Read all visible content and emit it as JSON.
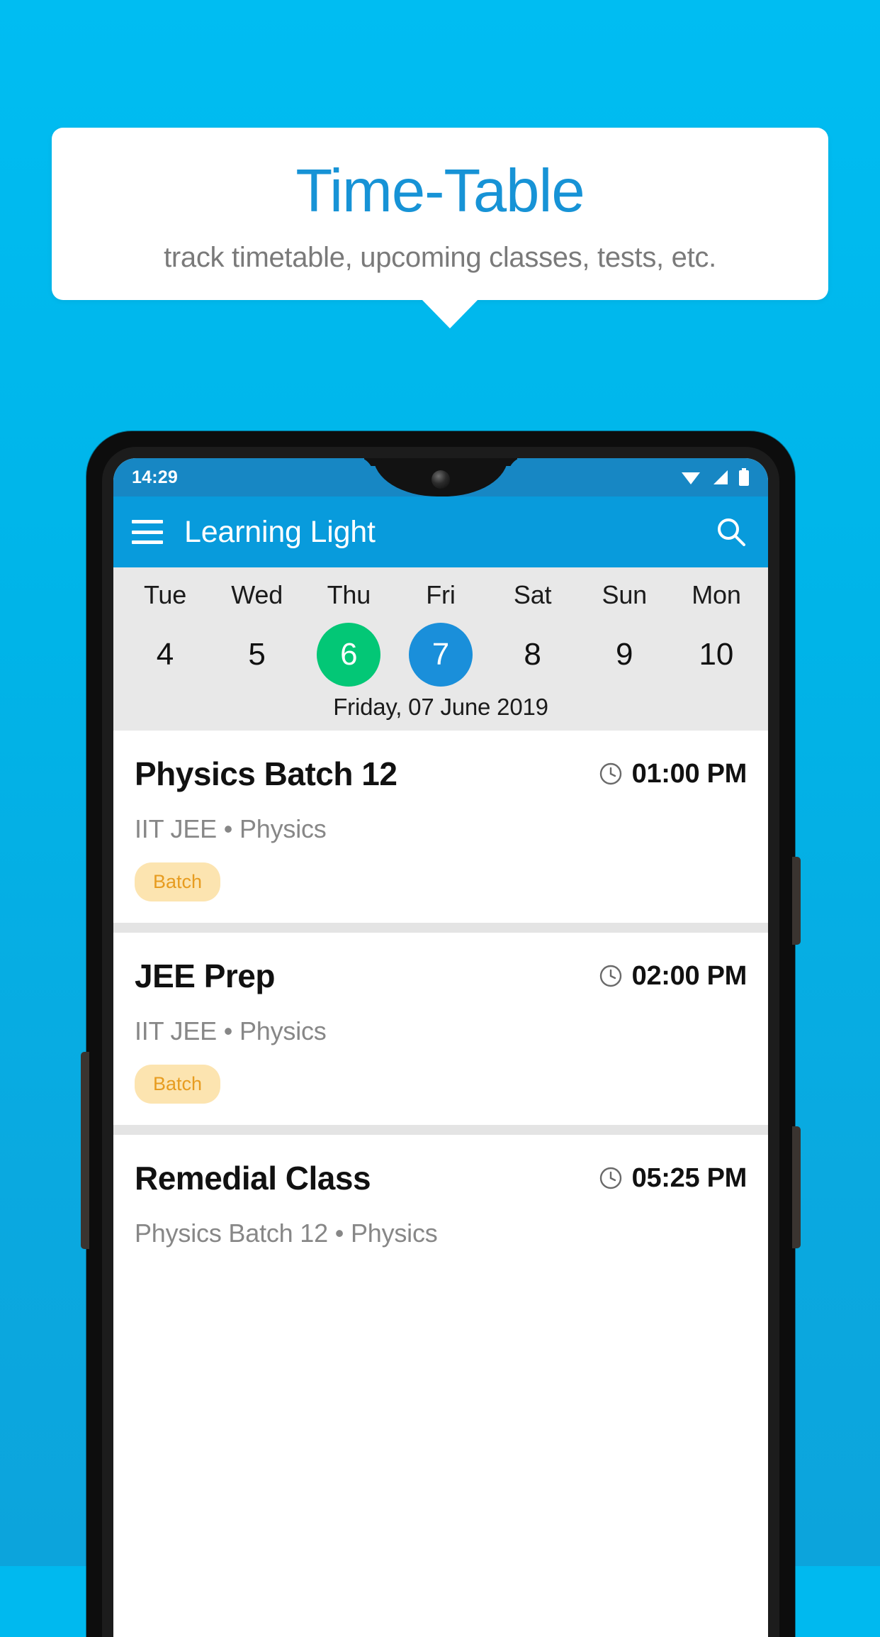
{
  "colors": {
    "background": "#00BDF2",
    "accent_blue": "#1793D6",
    "appbar_blue": "#089BDC",
    "statusbar_blue": "#1787C4",
    "selected_green": "#03C776",
    "selected_blue": "#1A8FDA",
    "badge_bg": "#FCE4B0",
    "badge_text": "#E79C20",
    "strip_gray": "#E8E8E8"
  },
  "callout": {
    "title": "Time-Table",
    "subtitle": "track timetable, upcoming classes, tests, etc."
  },
  "phone": {
    "statusbar": {
      "time": "14:29",
      "icons": [
        "wifi-icon",
        "signal-icon",
        "battery-icon"
      ]
    },
    "appbar": {
      "menu_icon": "hamburger-menu-icon",
      "title": "Learning Light",
      "search_icon": "search-icon"
    },
    "datestrip": {
      "days": [
        {
          "name": "Tue",
          "num": "4",
          "state": "normal"
        },
        {
          "name": "Wed",
          "num": "5",
          "state": "normal"
        },
        {
          "name": "Thu",
          "num": "6",
          "state": "today"
        },
        {
          "name": "Fri",
          "num": "7",
          "state": "selected"
        },
        {
          "name": "Sat",
          "num": "8",
          "state": "normal"
        },
        {
          "name": "Sun",
          "num": "9",
          "state": "normal"
        },
        {
          "name": "Mon",
          "num": "10",
          "state": "normal"
        }
      ],
      "date_label": "Friday, 07 June 2019"
    },
    "schedule": [
      {
        "title": "Physics Batch 12",
        "time": "01:00 PM",
        "time_icon": "clock-icon",
        "subtitle": "IIT JEE • Physics",
        "badge": "Batch"
      },
      {
        "title": "JEE Prep",
        "time": "02:00 PM",
        "time_icon": "clock-icon",
        "subtitle": "IIT JEE • Physics",
        "badge": "Batch"
      },
      {
        "title": "Remedial Class",
        "time": "05:25 PM",
        "time_icon": "clock-icon",
        "subtitle": "Physics Batch 12 • Physics",
        "badge": ""
      }
    ]
  }
}
